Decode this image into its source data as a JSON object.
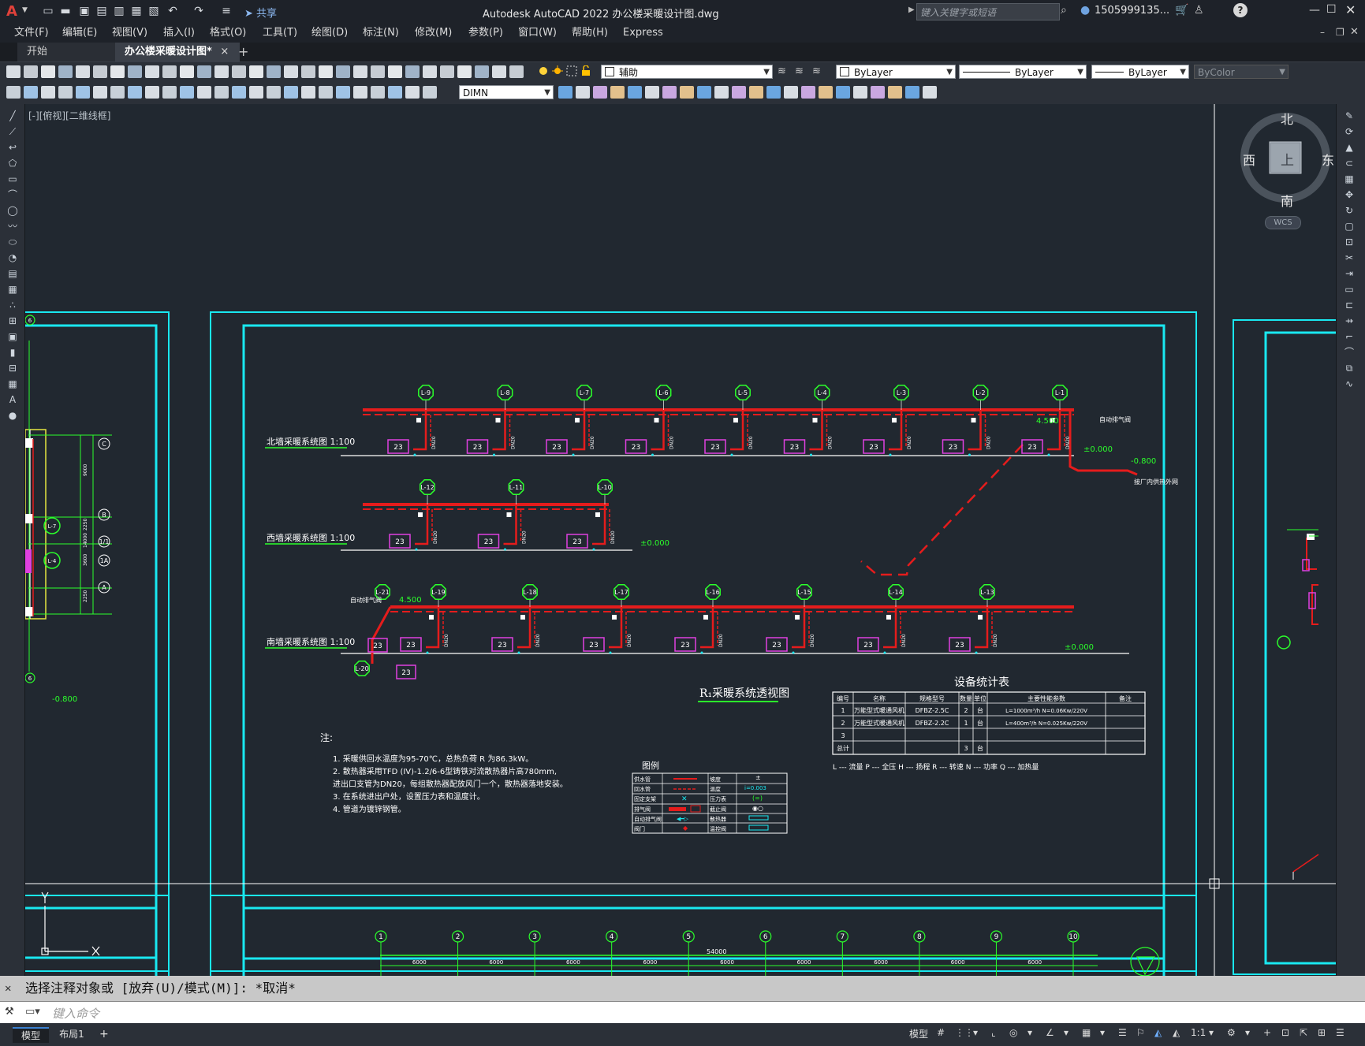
{
  "app": {
    "title": "Autodesk AutoCAD 2022    办公楼采暖设计图.dwg",
    "share_label": "共享",
    "search_placeholder": "键入关键字或短语",
    "user": "1505999135...",
    "help": "?"
  },
  "menu": [
    "文件(F)",
    "编辑(E)",
    "视图(V)",
    "插入(I)",
    "格式(O)",
    "工具(T)",
    "绘图(D)",
    "标注(N)",
    "修改(M)",
    "参数(P)",
    "窗口(W)",
    "帮助(H)",
    "Express"
  ],
  "tabs": {
    "start": "开始",
    "active": "办公楼采暖设计图*",
    "close": "×",
    "add": "+"
  },
  "toolbar": {
    "layer": "辅助",
    "color": "ByLayer",
    "linetype": "ByLayer",
    "lineweight": "ByLayer",
    "plotstyle": "ByColor",
    "dimstyle": "DIMN"
  },
  "viewport": {
    "label": "[-][俯视][二维线框]"
  },
  "viewcube": {
    "north": "北",
    "south": "南",
    "east": "东",
    "west": "西",
    "top": "上",
    "wcs": "WCS"
  },
  "drawing": {
    "north_label": "北墙采暖系统图 1:100",
    "west_label": "西墙采暖系统图 1:100",
    "south_label": "南墙采暖系统图 1:100",
    "system_title": "R₁采暖系统透视图",
    "legend_title": "图例",
    "table_title": "设备统计表",
    "table_headers": [
      "编号",
      "名称",
      "规格型号",
      "数量",
      "单位",
      "主要性能参数",
      "备注"
    ],
    "table_rows": [
      [
        "1",
        "万能型式暖通风机",
        "DFBZ-2.5C",
        "2",
        "台",
        "L=1000m³/h N=0.06Kw/220V",
        ""
      ],
      [
        "2",
        "万能型式暖通风机",
        "DFBZ-2.2C",
        "1",
        "台",
        "L=400m³/h N=0.025Kw/220V",
        ""
      ],
      [
        "3",
        "",
        "",
        "",
        "",
        "",
        ""
      ],
      [
        "总计",
        "",
        "",
        "3",
        "台",
        "",
        ""
      ]
    ],
    "table_note": "L --- 流量  P --- 全压  H --- 扬程  R --- 转速  N --- 功率  Q --- 加热量",
    "notes_title": "注:",
    "notes": [
      "1. 采暖供回水温度为95-70℃，总热负荷 R 为86.3kW。",
      "2. 散热器采用TFD (IV)-1.2/6-6型铸铁对流散热器片高780mm,",
      "   进出口支管为DN20，每组散热器配放风门一个，散热器落地安装。",
      "3. 在系统进出户处，设置压力表和温度计。",
      "4. 管道为镀锌钢管。"
    ],
    "unit_labels_north": [
      "L-9",
      "L-8",
      "L-7",
      "L-6",
      "L-5",
      "L-4",
      "L-3",
      "L-2",
      "L-1"
    ],
    "unit_labels_west": [
      "L-12",
      "L-11",
      "L-10"
    ],
    "unit_labels_south": [
      "L-21",
      "L-19",
      "L-18",
      "L-17",
      "L-16",
      "L-15",
      "L-14",
      "L-13"
    ],
    "unit_label_extra": "L-20",
    "radiator_value": "23",
    "elev_4500": "4.500",
    "elev_0": "±0.000",
    "elev_neg": "-0.800",
    "pipe_in": "接厂内供热外网",
    "auto_vent": "自动排气阀",
    "grid_labels": [
      "1",
      "2",
      "3",
      "4",
      "5",
      "6",
      "7",
      "8",
      "9",
      "10"
    ],
    "grid_dims": [
      "6000",
      "6000",
      "6000",
      "6000",
      "6000",
      "6000",
      "6000",
      "6000",
      "6000"
    ],
    "grid_total": "54000",
    "left_axis": [
      "C",
      "B",
      "1/1",
      "1A",
      "A"
    ],
    "left_units": [
      "L-7",
      "L-4"
    ],
    "left_dims": [
      "9000",
      "2250",
      "14000",
      "3600",
      "2250"
    ],
    "left_top_label": "6",
    "left_bottom_label": "6",
    "legend_items": [
      "供水管",
      "回水管",
      "固定支架",
      "排气阀",
      "自动排气阀",
      "阀门"
    ],
    "legend_items2": [
      "坡度",
      "温度",
      "压力表",
      "截止阀",
      "散热器",
      "温控阀"
    ]
  },
  "command": {
    "history": "选择注释对象或 [放弃(U)/模式(M)]: *取消*",
    "placeholder": "键入命令"
  },
  "status": {
    "model": "模型",
    "layout": "布局1",
    "add": "+",
    "model_btn": "模型",
    "scale": "1:1"
  }
}
